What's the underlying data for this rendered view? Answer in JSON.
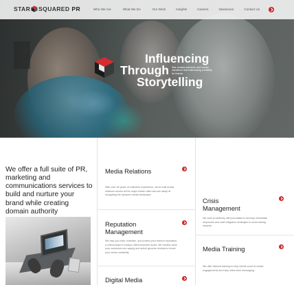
{
  "header": {
    "logo_left": "STAR",
    "logo_right": "SQUARED",
    "logo_suffix": "PR",
    "nav": [
      "Who We Are",
      "What We Do",
      "Our Work",
      "Insights",
      "Careers",
      "Newsroom",
      "Contact Us"
    ]
  },
  "hero": {
    "line1": "Influencing",
    "line2": "Through",
    "line3": "Storytelling",
    "tagline": "Star creates authentic and human narratives that build lasting credibility for brands"
  },
  "intro": {
    "text": "We offer a full suite of PR, marketing and communications services to build and nurture your brand while creating domain authority"
  },
  "services": [
    {
      "title": "Media Relations",
      "description": "With over 50 years of collective experience, we've built media relations across all the major Indian cities and are adept at navigating the dynamic media landscape"
    },
    {
      "title": "Reputation Management",
      "description": "We help you build, maintain, and protect your brand's reputation, a critical asset in today's interconnected world. We monitor what your customers are saying and solicit genuine reviews to boost your online credibility."
    },
    {
      "title": "Digital Media",
      "description": ""
    },
    {
      "title": "Crisis Management",
      "description": "We work proactively with journalists to develop immediate responses and craft mitigation strategies to avoid lasting impacts."
    },
    {
      "title": "Media Training",
      "description": "We offer tailored training to help clients excel at media engagements and help refine their messaging."
    }
  ],
  "colors": {
    "accent": "#c8282d"
  }
}
